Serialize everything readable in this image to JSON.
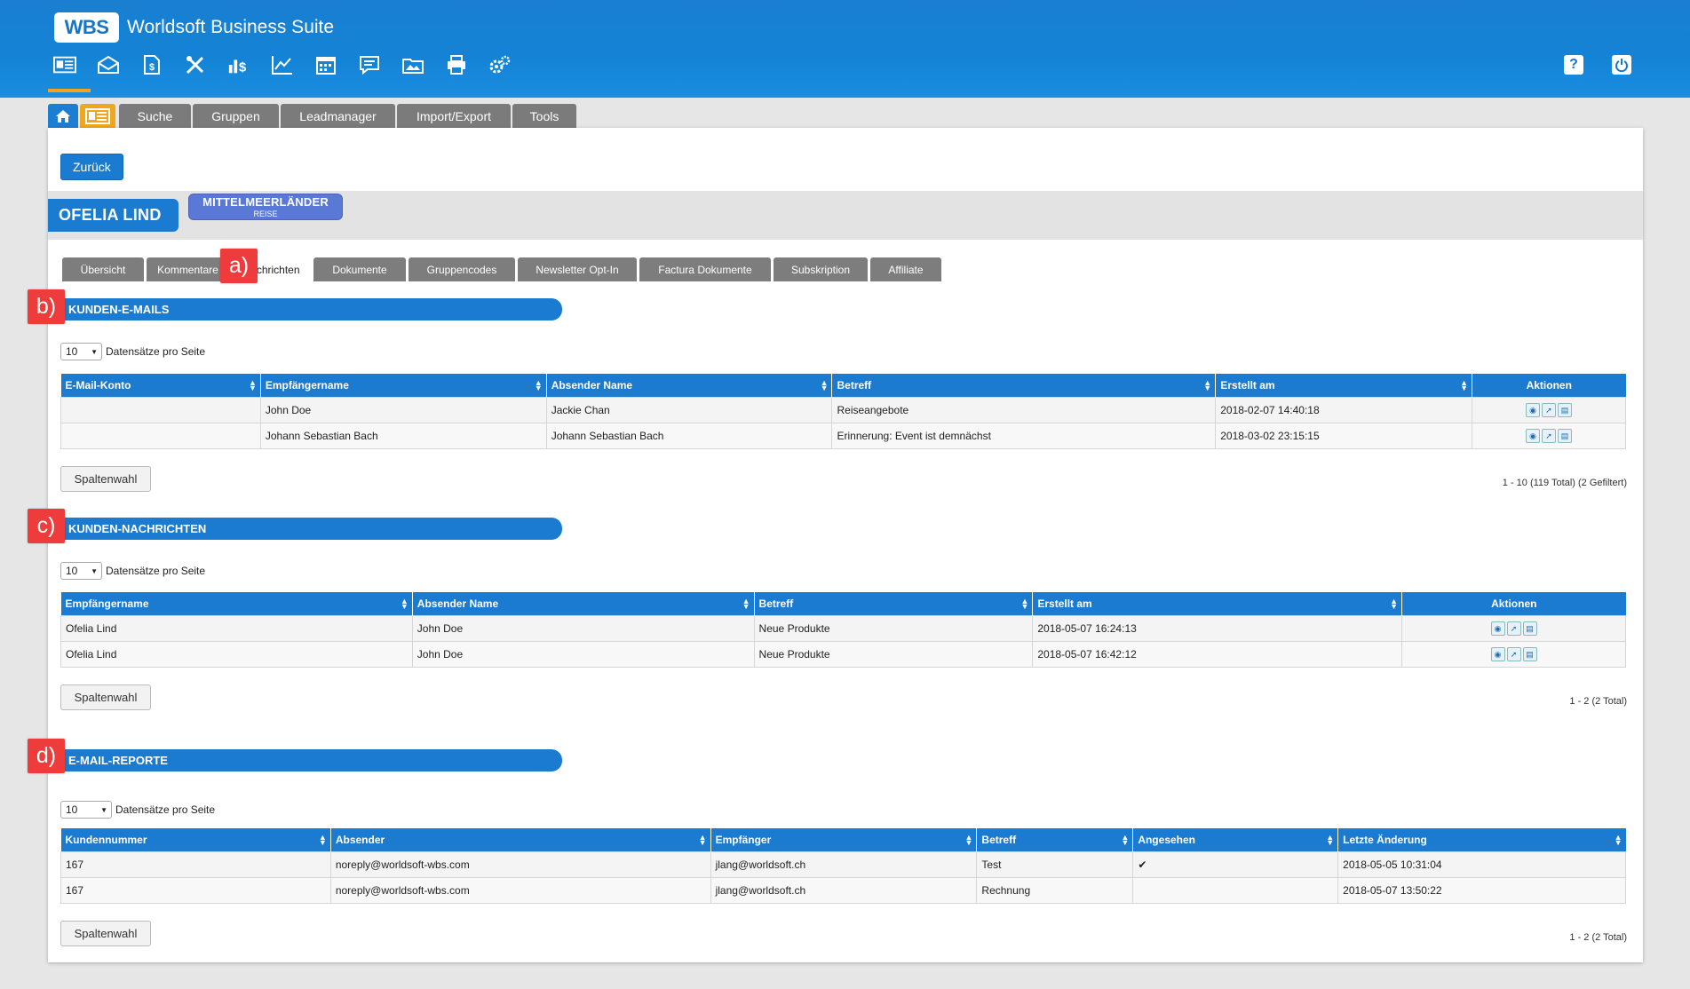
{
  "header": {
    "logo": "WBS",
    "app_name": "Worldsoft Business Suite",
    "nav_icons": [
      "contact-card-icon",
      "mail-icon",
      "document-money-icon",
      "tools-icon",
      "money-chart-icon",
      "line-chart-icon",
      "calendar-icon",
      "comment-icon",
      "folder-image-icon",
      "print-icon",
      "gears-icon"
    ],
    "help_label": "?",
    "power_label": "⏻"
  },
  "main_tabs": [
    "Suche",
    "Gruppen",
    "Leadmanager",
    "Import/Export",
    "Tools"
  ],
  "back_label": "Zurück",
  "contact": {
    "name": "OFELIA LIND",
    "group": "MITTELMEERLÄNDER",
    "group_sub": "REISE"
  },
  "sub_tabs": [
    "Übersicht",
    "Kommentare",
    "Nachrichten",
    "Dokumente",
    "Gruppencodes",
    "Newsletter Opt-In",
    "Factura Dokumente",
    "Subskription",
    "Affiliate"
  ],
  "callouts": [
    "a)",
    "b)",
    "c)",
    "d)"
  ],
  "per_page_label": "Datensätze pro Seite",
  "per_page_value": "10",
  "col_button": "Spaltenwahl",
  "emails": {
    "title": "KUNDEN-E-MAILS",
    "headers": [
      "E-Mail-Konto",
      "Empfängername",
      "Absender Name",
      "Betreff",
      "Erstellt am",
      "Aktionen"
    ],
    "rows": [
      [
        "",
        "John Doe",
        "Jackie Chan",
        "Reiseangebote",
        "2018-02-07 14:40:18"
      ],
      [
        "",
        "Johann Sebastian Bach",
        "Johann Sebastian Bach",
        "Erinnerung: Event ist demnächst",
        "2018-03-02 23:15:15"
      ]
    ],
    "count": "1 - 10 (119 Total) (2 Gefiltert)"
  },
  "messages": {
    "title": "KUNDEN-NACHRICHTEN",
    "headers": [
      "Empfängername",
      "Absender Name",
      "Betreff",
      "Erstellt am",
      "Aktionen"
    ],
    "rows": [
      [
        "Ofelia Lind",
        "John Doe",
        "Neue Produkte",
        "2018-05-07 16:24:13"
      ],
      [
        "Ofelia Lind",
        "John Doe",
        "Neue Produkte",
        "2018-05-07 16:42:12"
      ]
    ],
    "count": "1 - 2 (2 Total)"
  },
  "reports": {
    "title": "E-MAIL-REPORTE",
    "headers": [
      "Kundennummer",
      "Absender",
      "Empfänger",
      "Betreff",
      "Angesehen",
      "Letzte Änderung"
    ],
    "rows": [
      [
        "167",
        "noreply@worldsoft-wbs.com",
        "jlang@worldsoft.ch",
        "Test",
        "✔",
        "2018-05-05 10:31:04"
      ],
      [
        "167",
        "noreply@worldsoft-wbs.com",
        "jlang@worldsoft.ch",
        "Rechnung",
        "",
        "2018-05-07 13:50:22"
      ]
    ],
    "count": "1 - 2 (2 Total)"
  },
  "colors": {
    "primary": "#1a7bd1",
    "accent": "#f2a51e",
    "callout": "#ee3b3b",
    "badge": "#5a78d6"
  }
}
